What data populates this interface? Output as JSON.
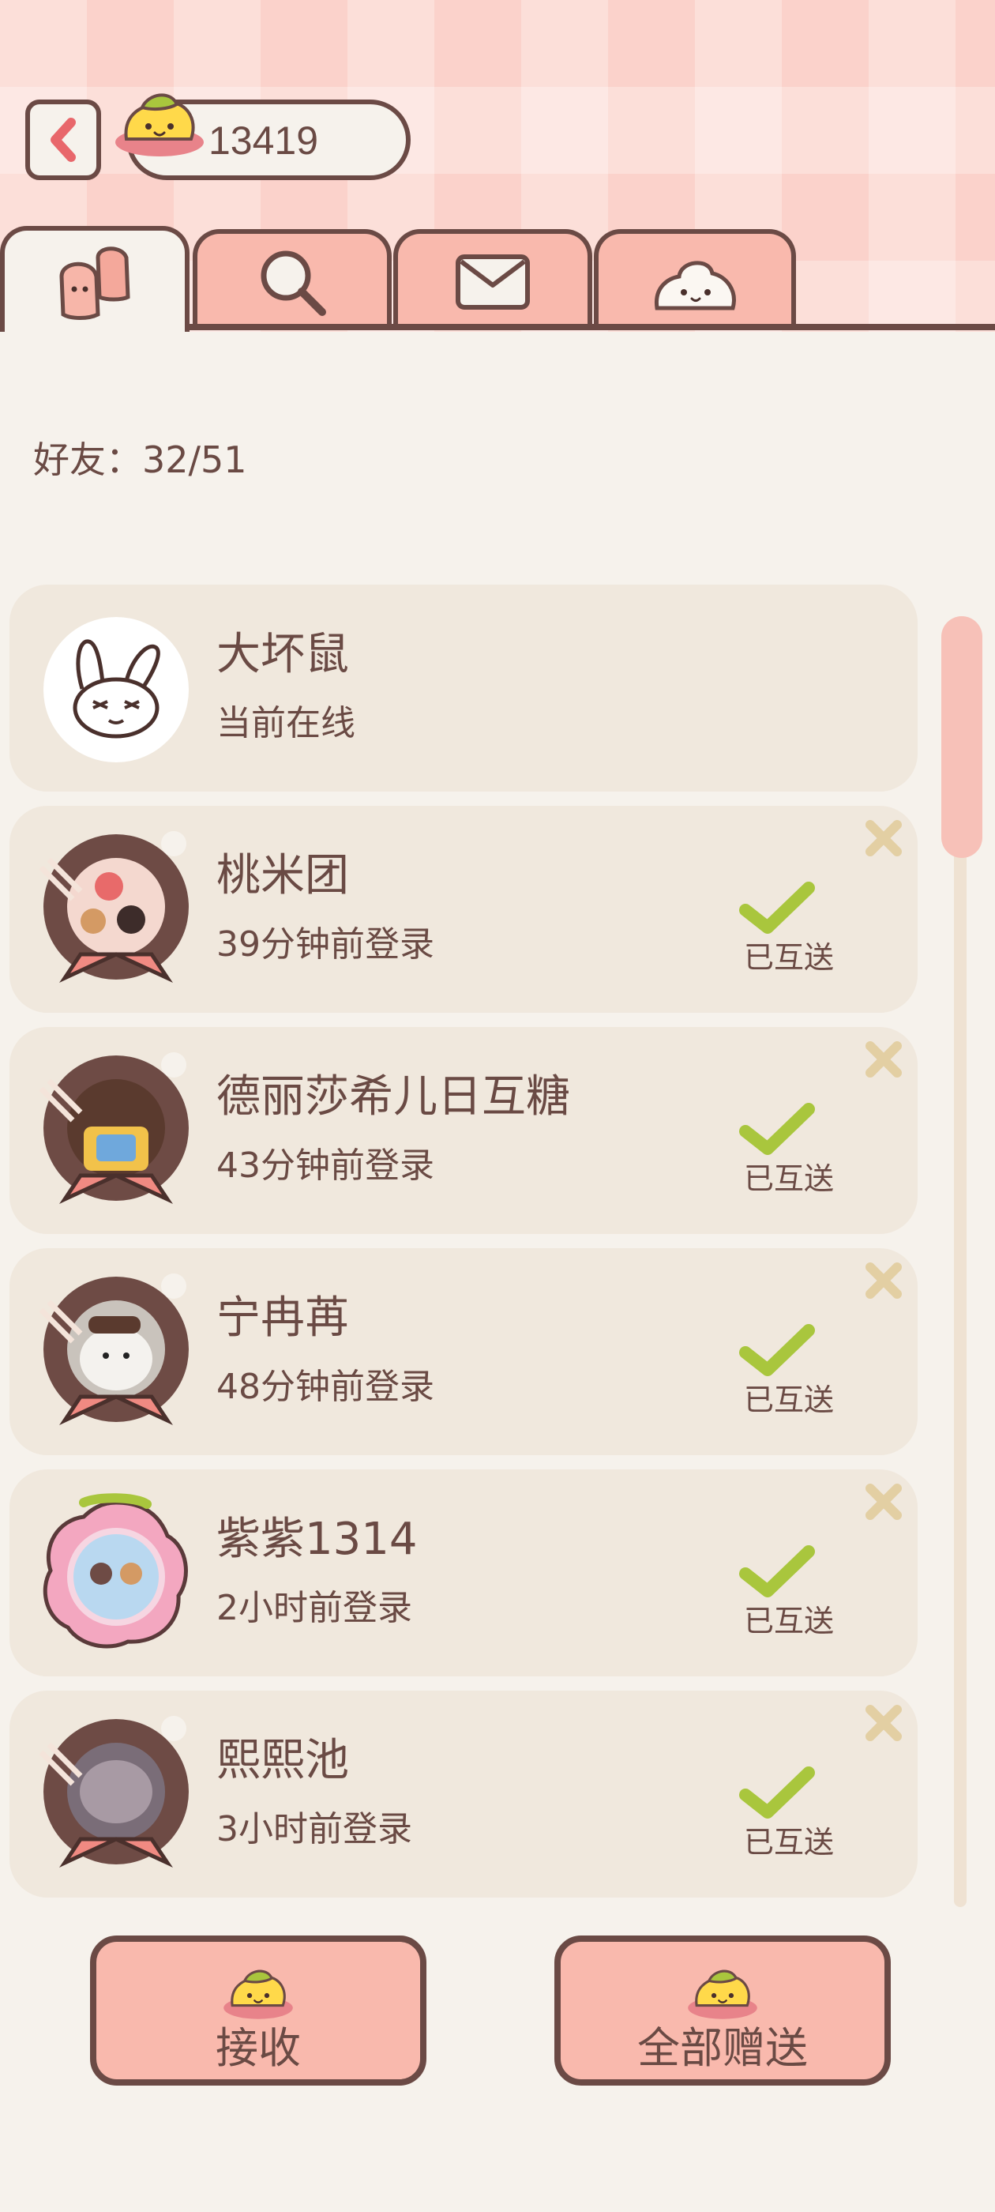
{
  "header": {
    "coin_count": "13419",
    "tabs": [
      {
        "name": "friends",
        "icon": "friends-icon",
        "active": true
      },
      {
        "name": "search",
        "icon": "search-icon"
      },
      {
        "name": "mail",
        "icon": "mail-icon"
      },
      {
        "name": "gift",
        "icon": "mochi-icon"
      }
    ]
  },
  "friends_count_label": "好友：32/51",
  "friends": [
    {
      "name": "大坏鼠",
      "status": "当前在线",
      "sent_label": "",
      "avatar": "rabbit-avatar"
    },
    {
      "name": "桃米团",
      "status": "39分钟前登录",
      "sent_label": "已互送",
      "avatar": "donut-avatar"
    },
    {
      "name": "德丽莎希儿日互糖",
      "status": "43分钟前登录",
      "sent_label": "已互送",
      "avatar": "donut-avatar"
    },
    {
      "name": "宁冉苒",
      "status": "48分钟前登录",
      "sent_label": "已互送",
      "avatar": "donut-avatar"
    },
    {
      "name": "紫紫1314",
      "status": "2小时前登录",
      "sent_label": "已互送",
      "avatar": "flower-avatar"
    },
    {
      "name": "熙熙池",
      "status": "3小时前登录",
      "sent_label": "已互送",
      "avatar": "donut-avatar"
    }
  ],
  "buttons": {
    "receive_label": "接收",
    "send_all_label": "全部赠送"
  },
  "colors": {
    "accent_pink": "#f9b9ad",
    "outline_brown": "#6b4a45",
    "check_green": "#a9c63d",
    "remove_tan": "#e3cfa3"
  }
}
